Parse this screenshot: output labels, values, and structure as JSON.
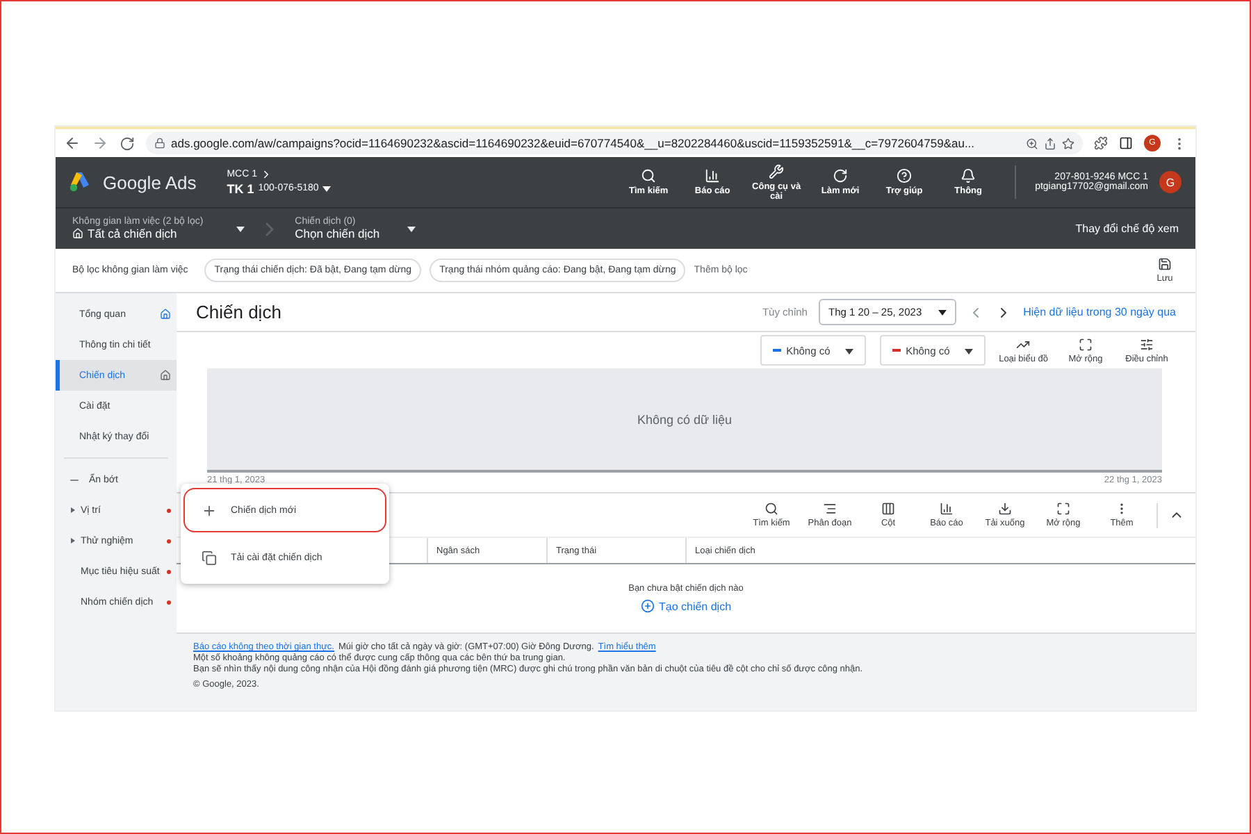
{
  "browser": {
    "url": "ads.google.com/aw/campaigns?ocid=1164690232&ascid=1164690232&euid=670774540&__u=8202284460&uscid=1159352591&__c=7972604759&au...",
    "profile": "G"
  },
  "header": {
    "product": "Google Ads",
    "account_top": "MCC 1",
    "account": "TK 1",
    "account_id": "100-076-5180",
    "actions": [
      "Tìm kiếm",
      "Báo cáo",
      "Công cụ và cài",
      "Làm mới",
      "Trợ giúp",
      "Thông"
    ],
    "user_phone": "207-801-9246 MCC 1",
    "user_email": "ptgiang17702@gmail.com",
    "avatar": "G"
  },
  "nav": {
    "workspace_label": "Không gian làm việc (2 bộ lọc)",
    "workspace_value": "Tất cả chiến dịch",
    "campaign_label": "Chiến dịch (0)",
    "campaign_value": "Chọn chiến dịch",
    "view_mode": "Thay đổi chế độ xem"
  },
  "filters": {
    "label": "Bộ lọc không gian làm việc",
    "chips": [
      "Trạng thái chiến dịch: Đã bật, Đang tạm dừng",
      "Trạng thái nhóm quảng cáo: Đang bật, Đang tạm dừng"
    ],
    "add": "Thêm bộ lọc",
    "save": "Lưu"
  },
  "sidebar": {
    "items": [
      {
        "label": "Tổng quan",
        "selected": false,
        "home": true
      },
      {
        "label": "Thông tin chi tiết",
        "selected": false,
        "home": false
      },
      {
        "label": "Chiến dịch",
        "selected": true,
        "home": true
      },
      {
        "label": "Cài đặt",
        "selected": false,
        "home": false
      },
      {
        "label": "Nhật ký thay đổi",
        "selected": false,
        "home": false
      }
    ],
    "collapse": "Ẩn bớt",
    "more": [
      {
        "label": "Vị trí",
        "expandable": true,
        "alert": true
      },
      {
        "label": "Thử nghiệm",
        "expandable": true,
        "alert": true
      },
      {
        "label": "Mục tiêu hiệu suất",
        "expandable": false,
        "alert": true
      },
      {
        "label": "Nhóm chiến dịch",
        "expandable": false,
        "alert": true
      }
    ]
  },
  "page": {
    "title": "Chiến dịch",
    "range_label": "Tùy chỉnh",
    "date_range": "Thg 1 20 – 25, 2023",
    "show_30": "Hiện dữ liệu trong 30 ngày qua"
  },
  "chart": {
    "metrics": [
      {
        "label": "Không có",
        "color": "#1a73e8"
      },
      {
        "label": "Không có",
        "color": "#d93025"
      }
    ],
    "tools": [
      "Loại biểu đồ",
      "Mở rộng",
      "Điều chỉnh"
    ],
    "empty": "Không có dữ liệu",
    "start_date": "21 thg 1, 2023",
    "end_date": "22 thg 1, 2023"
  },
  "table": {
    "tools": [
      "Tìm kiếm",
      "Phân đoạn",
      "Cột",
      "Báo cáo",
      "Tải xuống",
      "Mở rộng",
      "Thêm"
    ],
    "columns": [
      "Ngân sách",
      "Trạng thái",
      "Loại chiến dịch"
    ],
    "empty": "Bạn chưa bật chiến dịch nào",
    "create": "Tạo chiến dịch"
  },
  "menu": {
    "items": [
      {
        "label": "Chiến dịch mới",
        "highlighted": true
      },
      {
        "label": "Tải cài đặt chiến dịch",
        "highlighted": false
      }
    ]
  },
  "footer": {
    "link": "Báo cáo không theo thời gian thực.",
    "timezone": "Múi giờ cho tất cả ngày và giờ: (GMT+07:00) Giờ Đông Dương.",
    "learn_more": "Tìm hiểu thêm",
    "lines": [
      "Một số khoảng không quảng cáo có thể được cung cấp thông qua các bên thứ ba trung gian.",
      "Bạn sẽ nhìn thấy nội dung công nhận của Hội đồng đánh giá phương tiện (MRC) được ghi chú trong phần văn bản di chuột của tiêu đề cột cho chỉ số được công nhận."
    ],
    "copyright": "© Google, 2023."
  }
}
